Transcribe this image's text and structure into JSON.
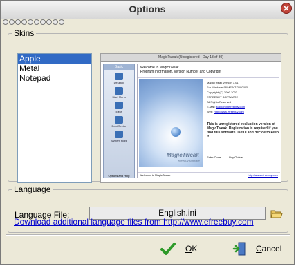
{
  "window": {
    "title": "Options"
  },
  "skins": {
    "legend": "Skins",
    "items": [
      "Apple",
      "Metal",
      "Notepad"
    ],
    "selected": "Apple"
  },
  "preview": {
    "title": "MagicTweak (Unregistered - Day 13 of 30)",
    "sidebar_head": "Basic",
    "sidebar_items": [
      "Desktop",
      "Start Menu",
      "Ease",
      "Boot Sector",
      "System tools"
    ],
    "sidebar_foot": "Options and Help",
    "welcome": "Welcome to MagicTweak",
    "welcome_sub": "Program Information, Version Number and Copyright",
    "info_lines": [
      "MagicTweak Version 3.01",
      "For Windows 98/ME/NT/2000/XP",
      "Copyright (C) 2000-2003",
      "EFREEBUY SOFTWARE",
      "All Rights Reserved"
    ],
    "email_label": "E-Mail:",
    "email": "support@efreebuy.com",
    "web_label": "Web:",
    "web": "http://www.efreebuy.com",
    "warning": "This is unregistered evaluation version of MagicTweak. Registration is required if you find this software useful and decide to keep it.",
    "enter_code": "Enter Code",
    "buy_online": "Buy Online",
    "brand": "MagicTweak",
    "brand_sub": "efreebuy software",
    "status_left": "Welcome to MagicTweak",
    "status_right": "http://www.efreebuy.com"
  },
  "language": {
    "legend": "Language",
    "file_label": "Language File:",
    "file_value": "English.ini",
    "download_link": "Download additional language files from http://www.efreebuy.com"
  },
  "buttons": {
    "ok_accel": "O",
    "ok_rest": "K",
    "cancel_accel": "C",
    "cancel_rest": "ancel"
  }
}
